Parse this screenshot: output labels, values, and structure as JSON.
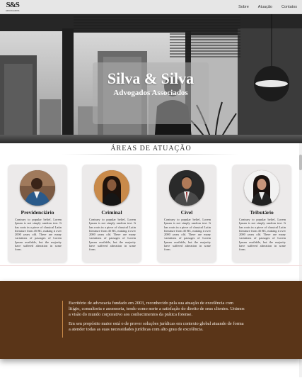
{
  "nav": {
    "logo_mark": "S&S",
    "logo_sub": "ADVOGADOS",
    "items": [
      "Sobre",
      "Atuação",
      "Contatos"
    ]
  },
  "hero": {
    "title": "Silva & Silva",
    "subtitle": "Advogados Associados"
  },
  "areas": {
    "title": "ÁREAS DE ATUAÇÃO",
    "cards": [
      {
        "title": "Previdenciário",
        "text": "Contrary to popular belief, Lorem Ipsum is not simply random text. It has roots in a piece of classical Latin literature from 45 BC, making it over 2000 years old. There are many variations of passages of Lorem Ipsum available, but the majority have suffered alteration in some form."
      },
      {
        "title": "Criminal",
        "text": "Contrary to popular belief, Lorem Ipsum is not simply random text. It has roots in a piece of classical Latin literature from 45 BC, making it over 2000 years old. There are many variations of passages of Lorem Ipsum available, but the majority have suffered alteration in some form."
      },
      {
        "title": "Cível",
        "text": "Contrary to popular belief, Lorem Ipsum is not simply random text. It has roots in a piece of classical Latin literature from 45 BC, making it over 2000 years old. There are many variations of passages of Lorem Ipsum available, but the majority have suffered alteration in some form."
      },
      {
        "title": "Tributário",
        "text": "Contrary to popular belief, Lorem Ipsum is not simply random text. It has roots in a piece of classical Latin literature from 45 BC, making it over 2000 years old. There are many variations of passages of Lorem Ipsum available, but the majority have suffered alteration in some form."
      }
    ]
  },
  "about": {
    "paragraph1": "Escritório de advocacia fundado em 2003, reconhecido pela sua atuação de excelência com litígio, consultoria e assessoria, tendo como norte a satisfação do direito de seus clientes. Unimos a visão do mundo corporativo aos conhecimentos da prática forense.",
    "paragraph2": "Em seu propósito maior está o de prover soluções jurídicas em contexto global atuando de forma a atender todas as suas necessidades jurídicas com alto grau de excelência."
  },
  "colors": {
    "about_bg": "#5a3518",
    "accent_line": "#c98a4a",
    "nav_bg": "#e6e6e6",
    "card_bg": "#eceaea"
  }
}
